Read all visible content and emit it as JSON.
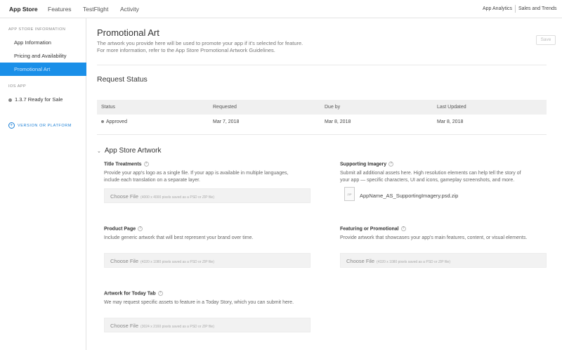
{
  "topnav": {
    "tabs": [
      {
        "label": "App Store",
        "active": true
      },
      {
        "label": "Features",
        "active": false
      },
      {
        "label": "TestFlight",
        "active": false
      },
      {
        "label": "Activity",
        "active": false
      }
    ],
    "right_links": [
      "App Analytics",
      "Sales and Trends"
    ]
  },
  "sidebar": {
    "section1_heading": "APP STORE INFORMATION",
    "items": [
      {
        "label": "App Information"
      },
      {
        "label": "Pricing and Availability"
      },
      {
        "label": "Promotional Art",
        "active": true
      }
    ],
    "section2_heading": "IOS APP",
    "version_item": "1.3.7 Ready for Sale",
    "add_link": "VERSION OR PLATFORM"
  },
  "page": {
    "title": "Promotional Art",
    "subtitle_line1": "The artwork you provide here will be used to promote your app if it's selected for feature.",
    "subtitle_line2": "For more information, refer to the App Store Promotional Artwork Guidelines.",
    "save_label": "Save"
  },
  "request_status": {
    "title": "Request Status",
    "columns": [
      "Status",
      "Requested",
      "Due by",
      "Last Updated"
    ],
    "row": {
      "status": "Approved",
      "requested": "Mar 7, 2018",
      "due_by": "Mar 8, 2018",
      "last_updated": "Mar 8, 2018"
    }
  },
  "artwork": {
    "title": "App Store Artwork",
    "help_icon": "question-icon",
    "title_treatments": {
      "label": "Title Treatments",
      "desc_line1": "Provide your app's logo as a single file. If your app is available in multiple languages,",
      "desc_line2": "include each translation on a separate layer.",
      "choose": "Choose File",
      "hint": "(4000 x 4000 pixels saved as a PSD or ZIP file)"
    },
    "supporting_imagery": {
      "label": "Supporting Imagery",
      "desc_line1": "Submit all additional assets here. High resolution elements can help tell the story of",
      "desc_line2": "your app — specific characters, UI and icons, gameplay screenshots, and more.",
      "file_icon_label": "ZIP",
      "file_name": "AppName_AS_SupportingImagery.psd.zip"
    },
    "product_page": {
      "label": "Product Page",
      "desc": "Include generic artwork that will best represent your brand over time.",
      "choose": "Choose File",
      "hint": "(4320 x 1080 pixels saved as a PSD or ZIP file)"
    },
    "featuring": {
      "label": "Featuring or Promotional",
      "desc": "Provide artwork that showcases your app's main features, content, or visual elements.",
      "choose": "Choose File",
      "hint": "(4320 x 1080 pixels saved as a PSD or ZIP file)"
    },
    "today_tab": {
      "label": "Artwork for Today Tab",
      "desc": "We may request specific assets to feature in a Today Story, which you can submit here.",
      "choose": "Choose File",
      "hint": "(3024 x 2160 pixels saved as a PSD or ZIP file)"
    }
  },
  "colors": {
    "accent": "#1a8fe8",
    "link": "#1a7fd6"
  }
}
